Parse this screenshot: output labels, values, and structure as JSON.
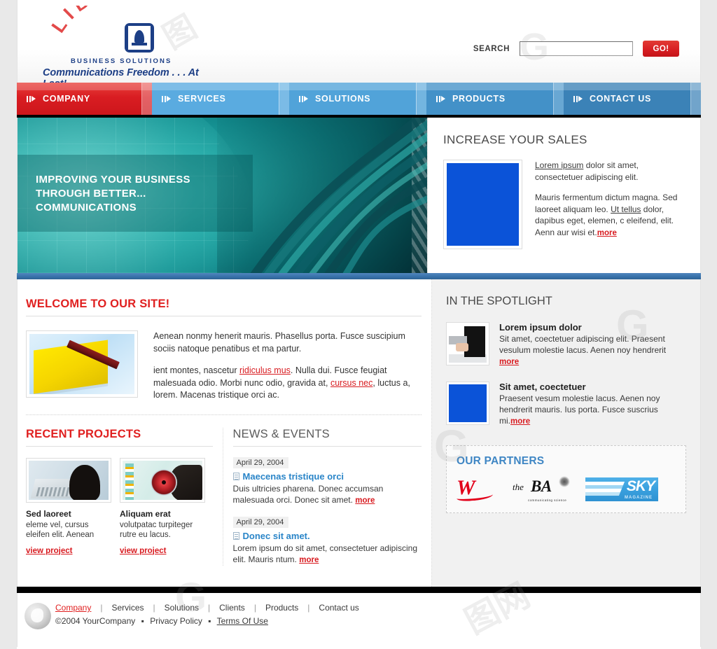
{
  "brand": {
    "arc_text": "LIBERTY",
    "tagline_small": "BUSINESS SOLUTIONS",
    "tagline_main": "Communications Freedom . . . At Last!",
    "bell_icon": "liberty-bell-icon"
  },
  "search": {
    "label": "SEARCH",
    "value": "",
    "placeholder": "",
    "button_label": "GO!"
  },
  "nav": {
    "items": [
      {
        "label": "COMPANY",
        "active": true,
        "color": "#d91d22"
      },
      {
        "label": "SERVICES",
        "active": false,
        "color": "#5aabe0"
      },
      {
        "label": "SOLUTIONS",
        "active": false,
        "color": "#51a3d9"
      },
      {
        "label": "PRODUCTS",
        "active": false,
        "color": "#4391c8"
      },
      {
        "label": "CONTACT US",
        "active": false,
        "color": "#3b82b7"
      }
    ]
  },
  "hero": {
    "line1": "IMPROVING YOUR BUSINESS",
    "line2": "THROUGH BETTER...",
    "line3": "COMMUNICATIONS"
  },
  "sales": {
    "title": "INCREASE YOUR SALES",
    "thumb_color": "#0b53d8",
    "para1_link": "Lorem ipsum",
    "para1_rest": " dolor sit amet, consectetuer adipiscing elit.",
    "para2_a": "Mauris fermentum dictum magna. Sed laoreet aliquam leo. ",
    "para2_link": "Ut tellus",
    "para2_b": " dolor, dapibus eget, elemen, c eleifend, elit. Aenn aur wisi et.",
    "more": "more"
  },
  "welcome": {
    "title": "WELCOME TO OUR SITE!",
    "para1": "Aenean nonmy henerit mauris. Phasellus porta. Fusce suscipium sociis natoque penatibus et ma partur.",
    "para2_a": "ient montes, nascetur ",
    "para2_link1": "ridiculus mus",
    "para2_b": ". Nulla dui. Fusce feugiat malesuada odio. Morbi nunc odio, gravida at, ",
    "para2_link2": "cursus nec",
    "para2_c": ", luctus a, lorem. Macenas tristique orci ac."
  },
  "projects": {
    "title": "RECENT PROJECTS",
    "items": [
      {
        "name": "Sed laoreet",
        "desc": "eleme vel, cursus eleifen elit. Aenean",
        "link": "view project",
        "thumb": "laptop-photo"
      },
      {
        "name": "Aliquam erat",
        "desc": "volutpatac turpiteger rutre eu lacus.",
        "link": "view project",
        "thumb": "dial-photo"
      }
    ]
  },
  "news": {
    "title": "NEWS & EVENTS",
    "items": [
      {
        "date": "April 29, 2004",
        "headline": "Maecenas tristique orci",
        "body": "Duis ultricies pharena. Donec accumsan malesuada orci. Donec sit amet.",
        "more": "more"
      },
      {
        "date": "April 29, 2004",
        "headline": "Donec sit amet.",
        "body": "Lorem ipsum do sit amet, consectetuer adipiscing elit. Mauris ntum.",
        "more": "more"
      }
    ]
  },
  "spotlight": {
    "title": "IN THE SPOTLIGHT",
    "items": [
      {
        "name": "Lorem ipsum dolor",
        "desc": "Sit amet, coectetuer adipiscing elit. Praesent vesulum molestie lacus. Aenen noy hendrerit",
        "more": "more",
        "thumb": "handshake-photo"
      },
      {
        "name": "Sit amet, coectetuer",
        "desc": "Praesent vesum molestie lacus. Aenen noy hendrerit mauris. Ius porta. Fusce suscrius mi.",
        "more": "more",
        "thumb": "blue-placeholder"
      }
    ]
  },
  "partners": {
    "title": "OUR PARTNERS",
    "logos": [
      {
        "name": "w-logo",
        "text": "W"
      },
      {
        "name": "the-ba-logo",
        "the": "the",
        "ba": "BA",
        "tag": "communicating science"
      },
      {
        "name": "sky-magazine-logo",
        "text": "SKY",
        "sub": "MAGAZINE"
      }
    ]
  },
  "footer": {
    "links": [
      "Company",
      "Services",
      "Solutions",
      "Clients",
      "Products",
      "Contact us"
    ],
    "copyright": "©2004 YourCompany",
    "privacy": "Privacy Policy",
    "terms": "Terms Of Use",
    "globe_icon": "globe-icon"
  }
}
